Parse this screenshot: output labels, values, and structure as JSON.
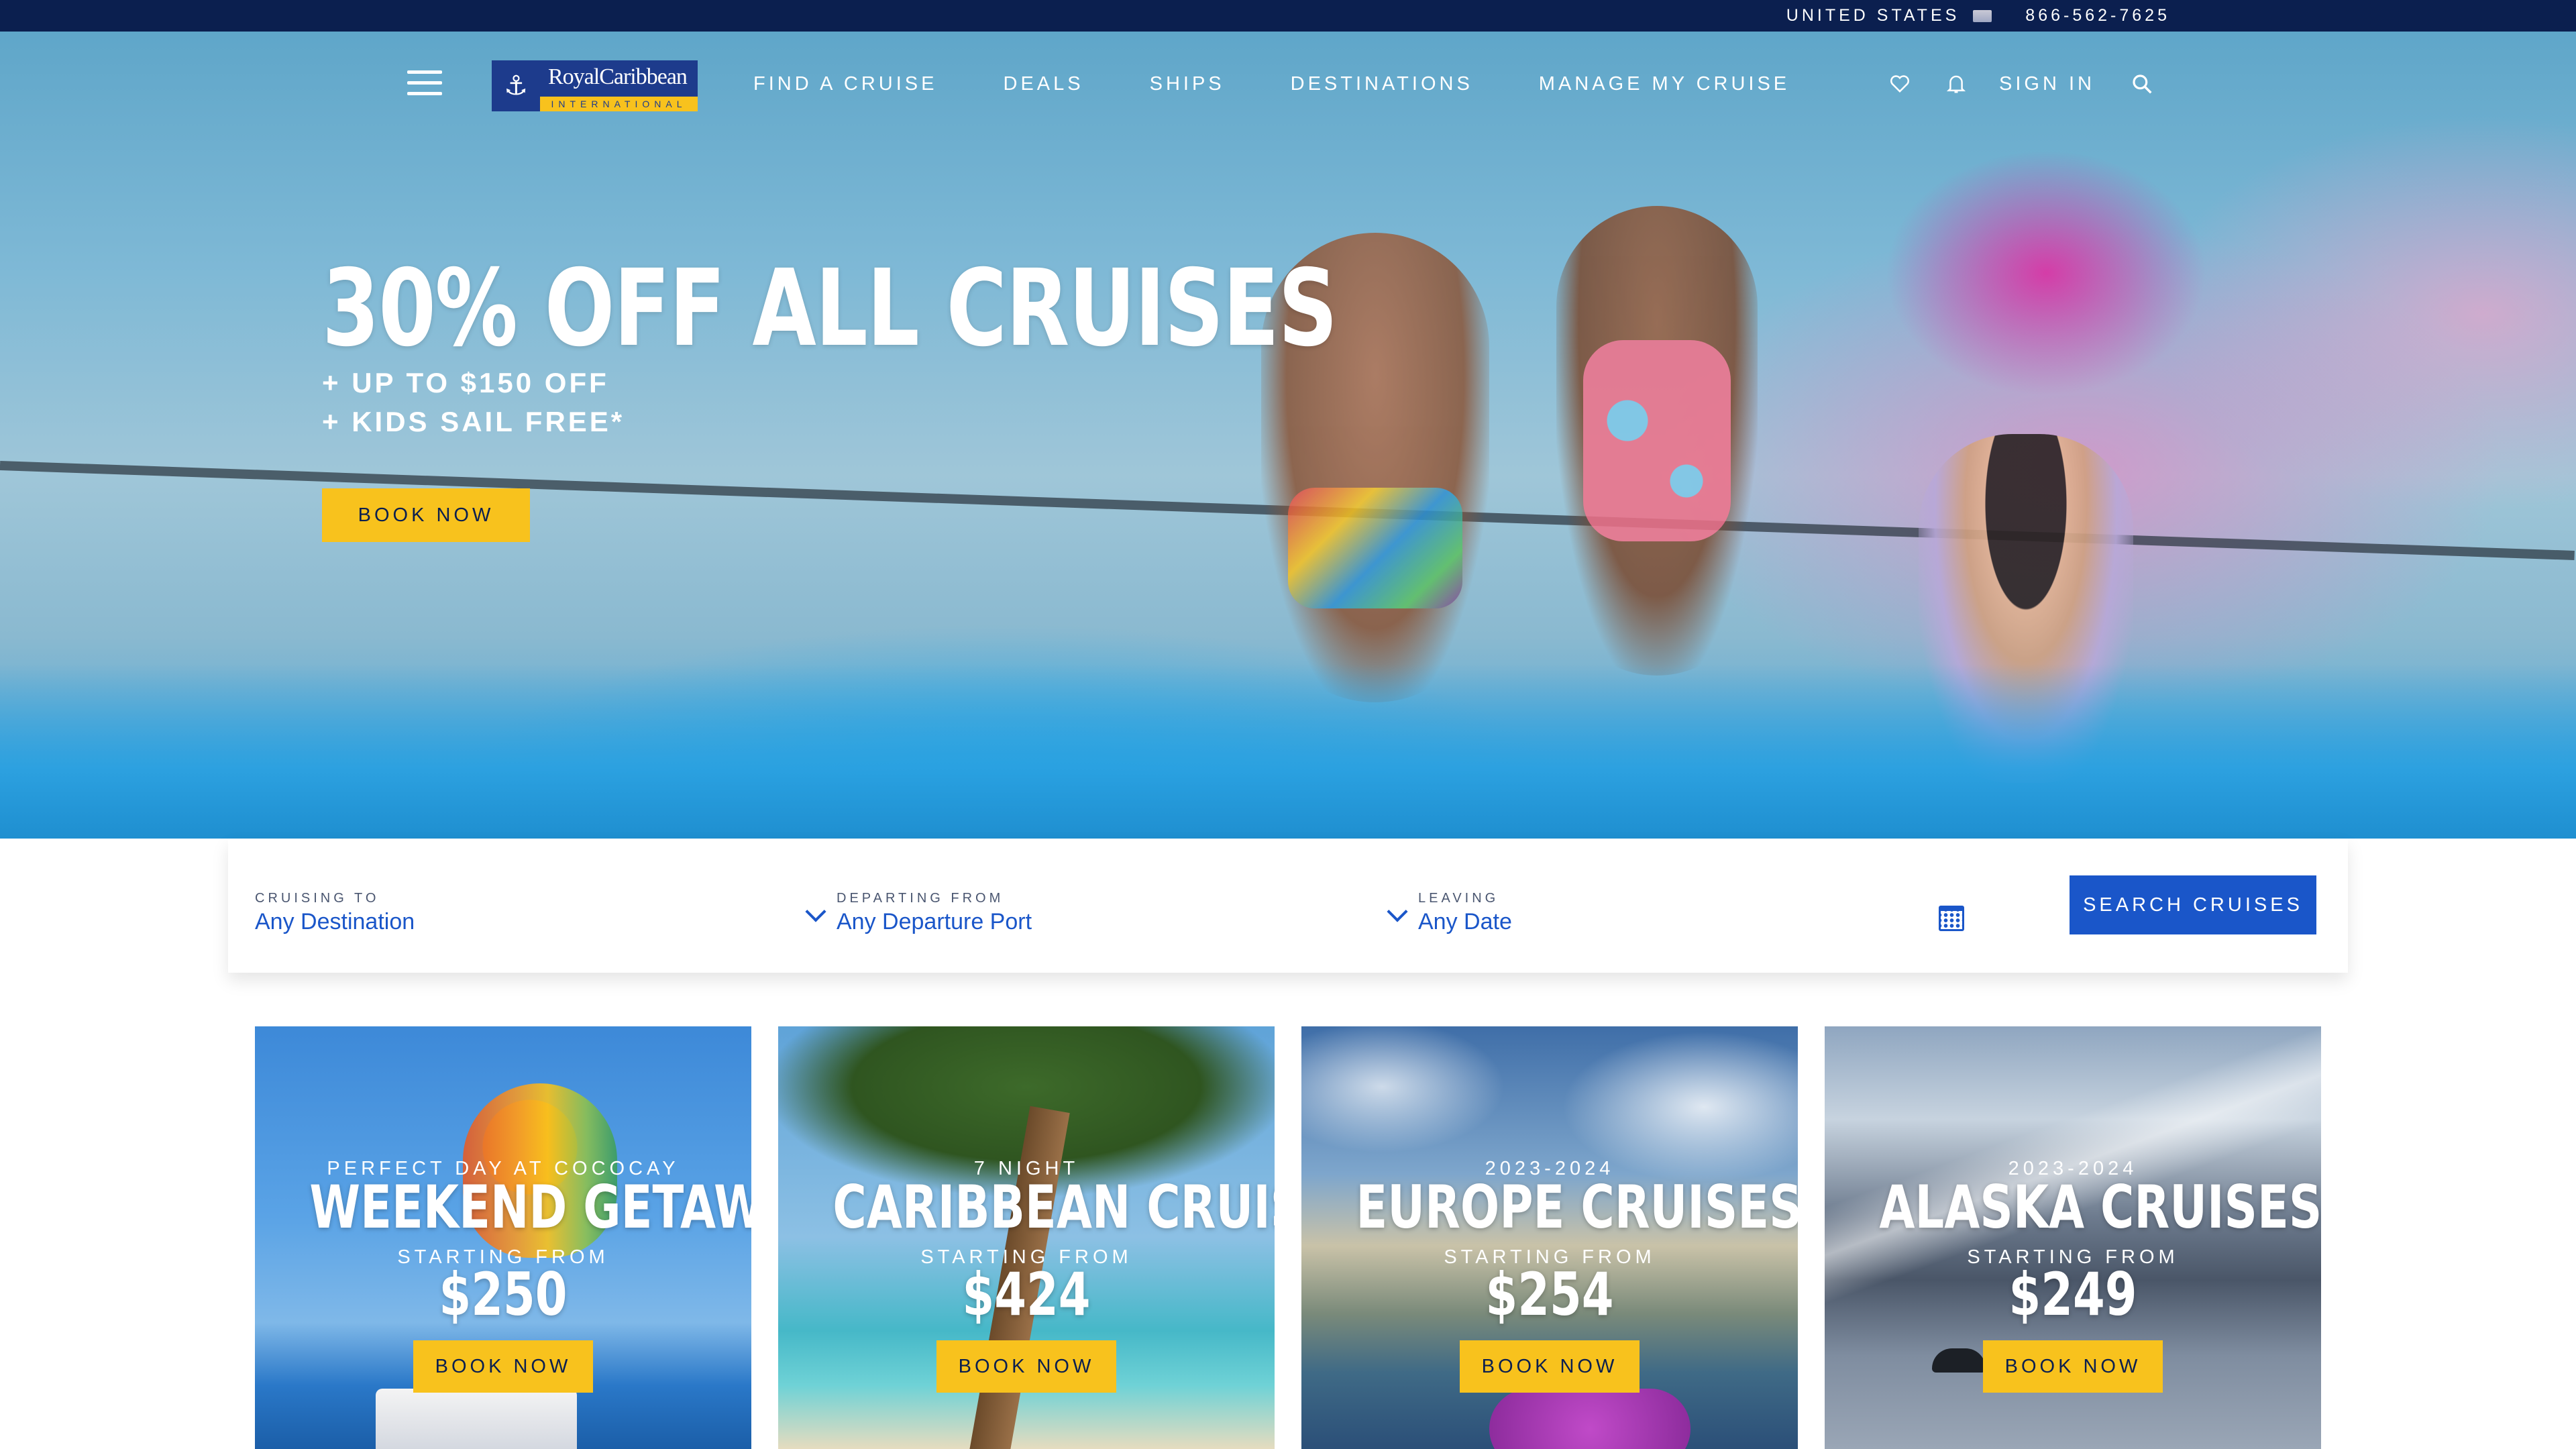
{
  "topbar": {
    "country": "UNITED STATES",
    "phone": "866-562-7625"
  },
  "brand": {
    "name": "RoyalCaribbean",
    "tagline": "INTERNATIONAL",
    "colors": {
      "navy": "#0b1f4f",
      "brand_blue": "#1d3b8c",
      "accent_yellow": "#f8c21d",
      "action_blue": "#1a56c9"
    }
  },
  "nav": {
    "links": [
      "FIND A CRUISE",
      "DEALS",
      "SHIPS",
      "DESTINATIONS",
      "MANAGE MY CRUISE"
    ],
    "sign_in": "SIGN IN",
    "icons": [
      "menu-icon",
      "heart-icon",
      "bell-icon",
      "search-icon"
    ]
  },
  "hero": {
    "title": "30% OFF ALL CRUISES",
    "sub1": "+ UP TO $150 OFF",
    "sub2": "+ KIDS SAIL FREE*",
    "cta": "BOOK NOW"
  },
  "search": {
    "destination": {
      "label": "CRUISING TO",
      "value": "Any Destination"
    },
    "departure": {
      "label": "DEPARTING FROM",
      "value": "Any Departure Port"
    },
    "date": {
      "label": "LEAVING",
      "value": "Any Date"
    },
    "button": "SEARCH CRUISES"
  },
  "cards": [
    {
      "eyebrow": "PERFECT DAY AT COCOCAY",
      "title": "WEEKEND GETAWAYS",
      "from": "STARTING FROM",
      "price": "$250",
      "cta": "BOOK NOW"
    },
    {
      "eyebrow": "7 NIGHT",
      "title": "CARIBBEAN CRUISES",
      "from": "STARTING FROM",
      "price": "$424",
      "cta": "BOOK NOW"
    },
    {
      "eyebrow": "2023-2024",
      "title": "EUROPE CRUISES",
      "from": "STARTING FROM",
      "price": "$254",
      "cta": "BOOK NOW"
    },
    {
      "eyebrow": "2023-2024",
      "title": "ALASKA CRUISES",
      "from": "STARTING FROM",
      "price": "$249",
      "cta": "BOOK NOW"
    }
  ]
}
